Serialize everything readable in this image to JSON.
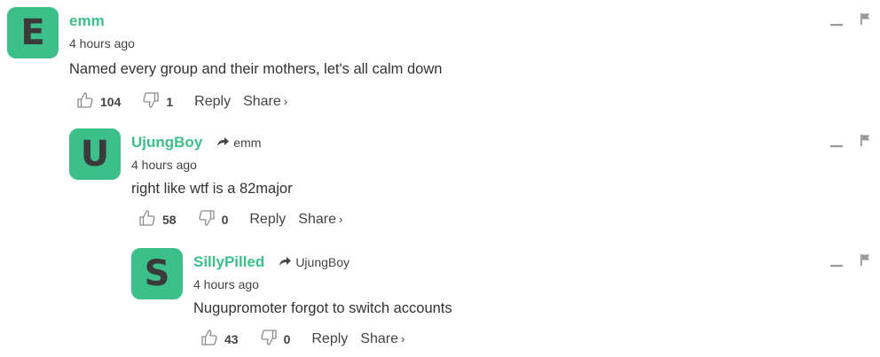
{
  "comments": [
    {
      "avatar_letter": "E",
      "author": "emm",
      "reply_to": "",
      "timestamp": "4 hours ago",
      "text": "Named every group and their mothers, let's all calm down",
      "upvotes": "104",
      "downvotes": "1",
      "reply_label": "Reply",
      "share_label": "Share",
      "share_chevron": "›"
    },
    {
      "avatar_letter": "U",
      "author": "UjungBoy",
      "reply_to": "emm",
      "timestamp": "4 hours ago",
      "text": "right like wtf is a 82major",
      "upvotes": "58",
      "downvotes": "0",
      "reply_label": "Reply",
      "share_label": "Share",
      "share_chevron": "›"
    },
    {
      "avatar_letter": "S",
      "author": "SillyPilled",
      "reply_to": "UjungBoy",
      "timestamp": "4 hours ago",
      "text": "Nugupromoter forgot to switch accounts",
      "upvotes": "43",
      "downvotes": "0",
      "reply_label": "Reply",
      "share_label": "Share",
      "share_chevron": "›"
    }
  ],
  "colors": {
    "accent": "#3dbf8a",
    "avatar_letter": "#3a3a3a",
    "text": "#333333",
    "muted": "#444444",
    "icon": "#9a9a9a"
  },
  "icons": {
    "like": "thumbs-up-icon",
    "dislike": "thumbs-down-icon",
    "reply_to": "reply-arrow-icon",
    "collapse": "minus-icon",
    "flag": "flag-icon"
  }
}
